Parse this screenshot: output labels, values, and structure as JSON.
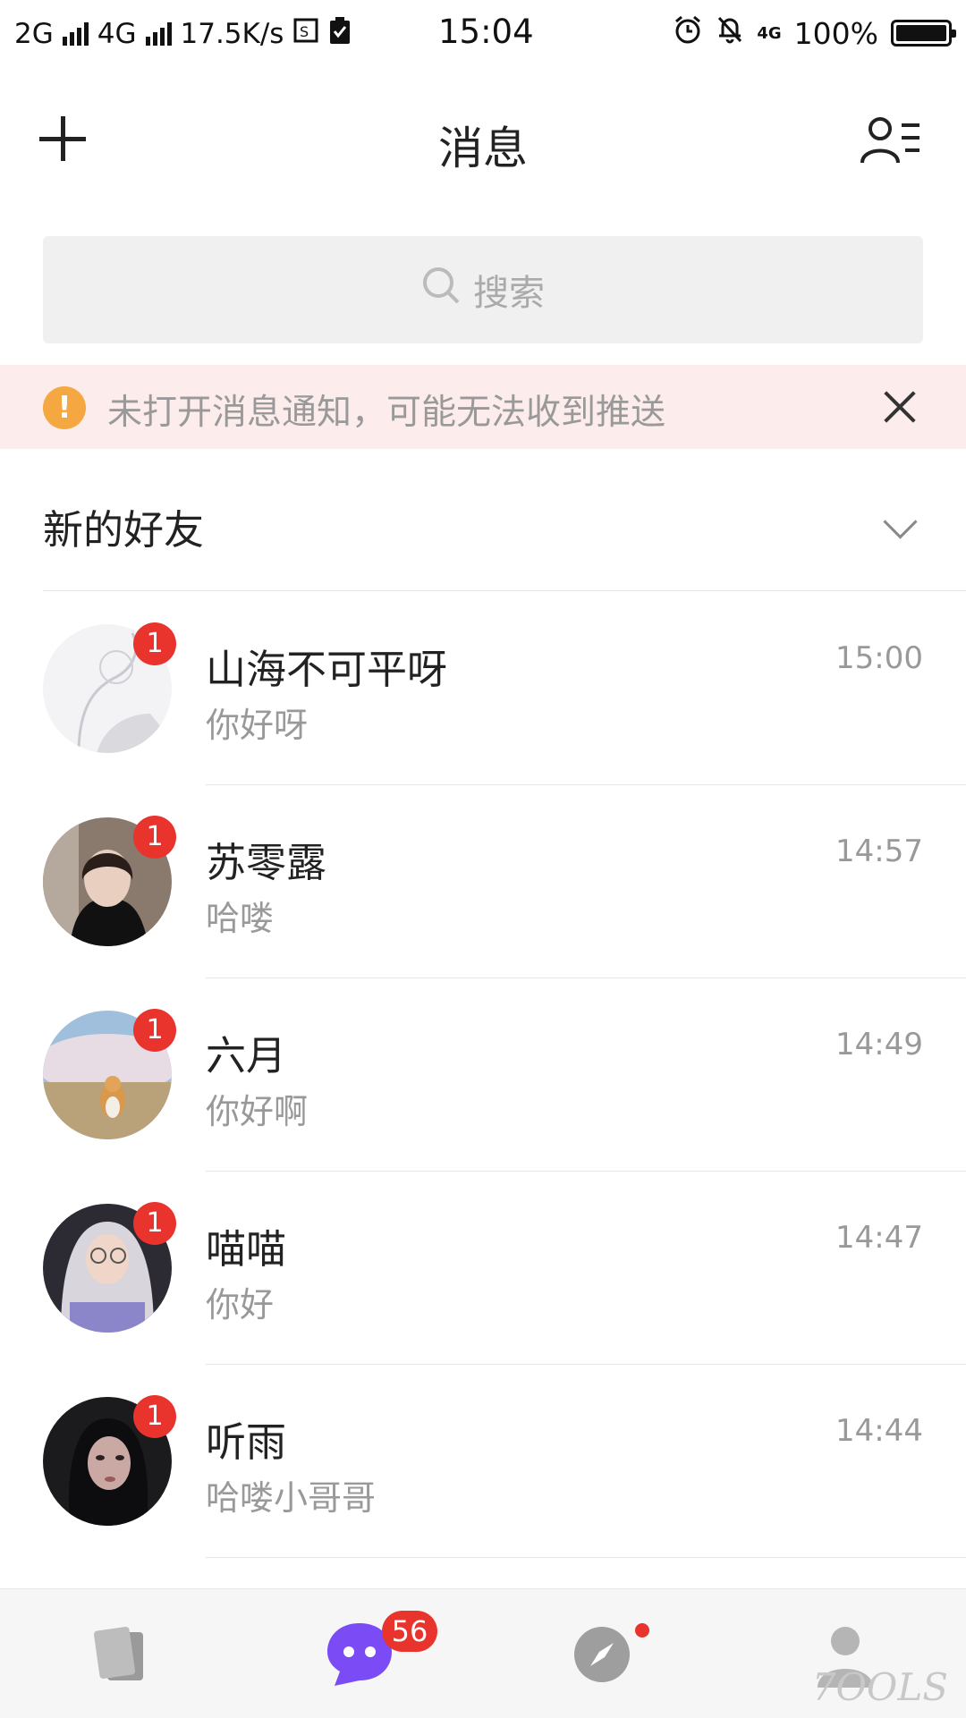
{
  "status_bar": {
    "network_left": "2G",
    "network_right": "4G",
    "speed": "17.5K/s",
    "time": "15:04",
    "network_type": "4G",
    "battery": "100%"
  },
  "header": {
    "title": "消息",
    "add_icon": "plus-icon",
    "contacts_icon": "contacts-list-icon"
  },
  "search": {
    "placeholder": "搜索",
    "icon": "search-icon"
  },
  "notice": {
    "text": "未打开消息通知，可能无法收到推送",
    "icon_glyph": "!"
  },
  "new_friends": {
    "label": "新的好友"
  },
  "chats": [
    {
      "name": "山海不可平呀",
      "message": "你好呀",
      "time": "15:00",
      "badge": "1"
    },
    {
      "name": "苏零露",
      "message": "哈喽",
      "time": "14:57",
      "badge": "1"
    },
    {
      "name": "六月",
      "message": "你好啊",
      "time": "14:49",
      "badge": "1"
    },
    {
      "name": "喵喵",
      "message": "你好",
      "time": "14:47",
      "badge": "1"
    },
    {
      "name": "听雨",
      "message": "哈喽小哥哥",
      "time": "14:44",
      "badge": "1"
    }
  ],
  "bottom_nav": {
    "messages_badge": "56",
    "icons": [
      "cards-icon",
      "chat-bubble-icon",
      "compass-icon",
      "profile-icon"
    ]
  },
  "colors": {
    "accent": "#7b4cf5",
    "badge": "#e8342c",
    "notice_bg": "#fdecec",
    "notice_icon": "#f5a742"
  },
  "watermark": "7OOLS"
}
